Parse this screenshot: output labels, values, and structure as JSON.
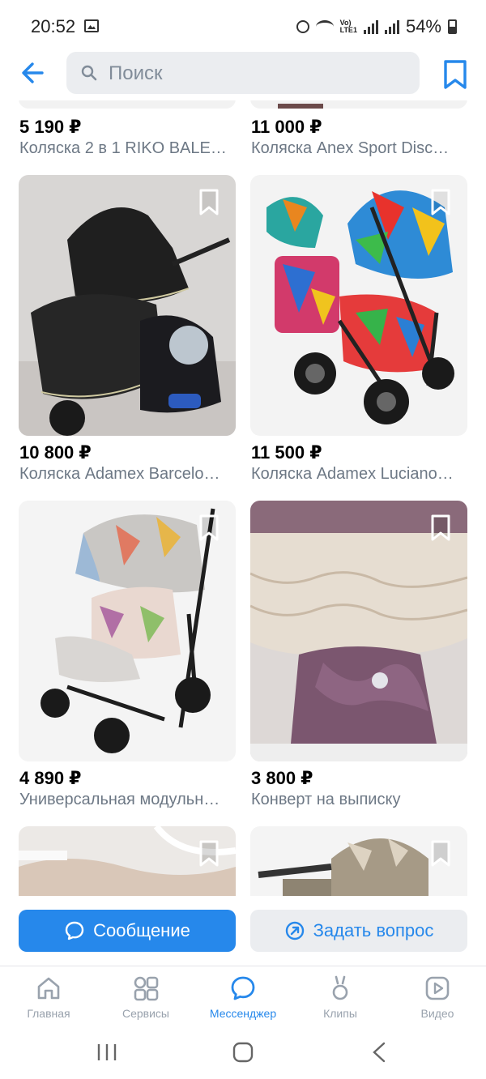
{
  "status_bar": {
    "time": "20:52",
    "volte_top": "Vo)",
    "volte_bottom": "LTE1",
    "battery": "54%"
  },
  "header": {
    "search_placeholder": "Поиск"
  },
  "listings": [
    {
      "price": "5 190 ₽",
      "title": "Коляска 2 в 1 RIKO BALE…"
    },
    {
      "price": "11 000 ₽",
      "title": "Коляска Anex Sport Disc…"
    },
    {
      "price": "10 800 ₽",
      "title": "Коляска Adamex Barcelo…"
    },
    {
      "price": "11 500 ₽",
      "title": "Коляска Adamex Luciano…"
    },
    {
      "price": "4 890 ₽",
      "title": "Универсальная модульн…"
    },
    {
      "price": "3 800 ₽",
      "title": "Конверт на выписку"
    }
  ],
  "actions": {
    "message_label": "Сообщение",
    "ask_label": "Задать вопрос"
  },
  "bottom_nav": [
    {
      "label": "Главная",
      "icon": "home-icon"
    },
    {
      "label": "Сервисы",
      "icon": "services-icon"
    },
    {
      "label": "Мессенджер",
      "icon": "messenger-icon"
    },
    {
      "label": "Клипы",
      "icon": "clips-icon"
    },
    {
      "label": "Видео",
      "icon": "video-icon"
    }
  ],
  "colors": {
    "accent": "#2688eb",
    "secondary_bg": "#ebedf0",
    "muted_text": "#6d7885"
  }
}
